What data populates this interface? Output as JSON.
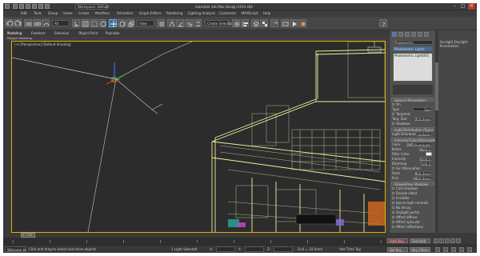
{
  "window": {
    "title": "Autodesk 3ds Max Design 2014 x64",
    "workspace": "Workspace: Default",
    "controls": [
      "–",
      "□",
      "✕"
    ]
  },
  "menu": {
    "items": [
      "Edit",
      "Tools",
      "Group",
      "Views",
      "Create",
      "Modifiers",
      "Animation",
      "Graph Editors",
      "Rendering",
      "Lighting Analysis",
      "Customize",
      "MAXScript",
      "Help"
    ]
  },
  "toolbar": {
    "selection_filter": "All",
    "view_dropdown": "View",
    "selection_set": "Create Selection Set",
    "icons": [
      "undo-icon",
      "redo-icon",
      "link-icon",
      "unlink-icon",
      "bind-spacewarp-icon",
      "select-icon",
      "select-by-name-icon",
      "select-region-icon",
      "window-crossing-icon",
      "move-icon",
      "rotate-icon",
      "scale-icon",
      "pivot-icon",
      "snap-icon",
      "angle-snap-icon",
      "percent-snap-icon",
      "mirror-icon",
      "align-icon",
      "layer-icon",
      "schematic-icon",
      "material-editor-icon",
      "render-setup-icon",
      "render-icon"
    ]
  },
  "ribbon": {
    "tabs": [
      "Modeling",
      "Freeform",
      "Selection",
      "Object Paint",
      "Populate"
    ],
    "sub_label": "Polygon Modeling"
  },
  "viewport": {
    "label": "[+] [Perspective] [Default Shading]",
    "accent": "#e0b000",
    "wire_color": "#f2f2a0"
  },
  "panel": {
    "object_name": "Photometric",
    "category": "Photometric Lights",
    "list_item": "Photometric Light001",
    "rollouts": {
      "general": "General Parameters",
      "light_properties": "Light Properties",
      "shape": "Shape/Area Shadows",
      "distribution": "Light Distribution (Type)",
      "intensity": "Intensity/Color/Attenuation",
      "advanced": "Advanced Effects"
    },
    "rows": [
      {
        "label": "On",
        "value": ""
      },
      {
        "label": "Type",
        "value": "Sun"
      },
      {
        "label": "Targeted",
        "value": ""
      },
      {
        "label": "Targ. Dist",
        "value": "250.0mm"
      },
      {
        "label": "Shadows",
        "value": ""
      },
      {
        "label": "Light Distribution",
        "value": "Uniform"
      },
      {
        "label": "Color",
        "value": "D65 Illuminant"
      },
      {
        "label": "Kelvin",
        "value": "3600.0"
      },
      {
        "label": "Filter Color",
        "value": ""
      },
      {
        "label": "Intensity",
        "value": "1500.0"
      },
      {
        "label": "Dimming",
        "value": "100.0"
      },
      {
        "label": "Far Attenuation",
        "value": ""
      },
      {
        "label": "Start",
        "value": "800.0mm"
      },
      {
        "label": "End",
        "value": "1000.0mm"
      },
      {
        "label": "Cast shadows",
        "value": ""
      },
      {
        "label": "Double sided",
        "value": ""
      },
      {
        "label": "Invisible",
        "value": ""
      },
      {
        "label": "Ignore light normals",
        "value": ""
      },
      {
        "label": "No decay",
        "value": ""
      },
      {
        "label": "Skylight portal",
        "value": ""
      },
      {
        "label": "Affect diffuse",
        "value": ""
      },
      {
        "label": "Affect specular",
        "value": ""
      },
      {
        "label": "Affect reflections",
        "value": ""
      },
      {
        "label": "Samples",
        "value": "8"
      },
      {
        "label": "Shadow bias",
        "value": "0.5"
      },
      {
        "label": "Jitter",
        "value": "1.0"
      }
    ]
  },
  "farright": {
    "header": "Sunlight Daylight Illumination"
  },
  "timeline": {
    "frame": "0 / 100",
    "ticks": [
      "0",
      "10",
      "20",
      "30",
      "40",
      "50",
      "60",
      "70",
      "80",
      "90",
      "100"
    ]
  },
  "statusbar": {
    "welcome": "Welcome to",
    "prompt": "Click and drag to select and move objects",
    "selected": "1 Light Selected",
    "x": "X:",
    "y": "Y:",
    "z": "Z:",
    "grid": "Grid = 10.0mm",
    "auto_key": "Auto Key",
    "set_key": "Set Key",
    "selected_dd": "Selected",
    "key_filters": "Key Filters...",
    "add_time_tag": "Add Time Tag"
  }
}
